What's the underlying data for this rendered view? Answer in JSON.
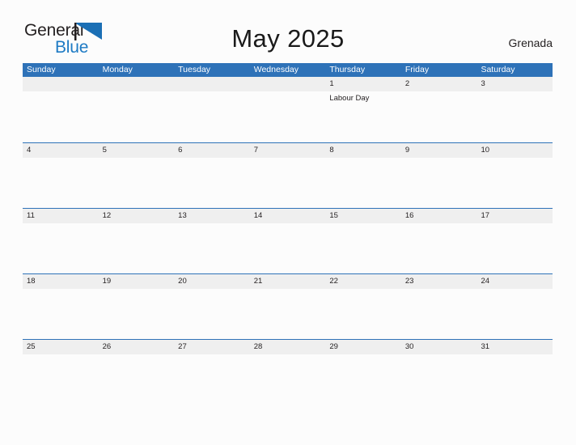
{
  "brand": {
    "name_part1": "General",
    "name_part2": "Blue",
    "flag_icon": "blue-triangle-flag-icon",
    "color_dark": "#231f20",
    "color_blue": "#1d7ac4"
  },
  "header": {
    "title": "May 2025",
    "location": "Grenada"
  },
  "calendar": {
    "accent_color": "#2e72b8",
    "band_color": "#efefef",
    "weekdays": [
      "Sunday",
      "Monday",
      "Tuesday",
      "Wednesday",
      "Thursday",
      "Friday",
      "Saturday"
    ],
    "weeks": [
      [
        {
          "date": ""
        },
        {
          "date": ""
        },
        {
          "date": ""
        },
        {
          "date": ""
        },
        {
          "date": "1",
          "events": [
            "Labour Day"
          ]
        },
        {
          "date": "2"
        },
        {
          "date": "3"
        }
      ],
      [
        {
          "date": "4"
        },
        {
          "date": "5"
        },
        {
          "date": "6"
        },
        {
          "date": "7"
        },
        {
          "date": "8"
        },
        {
          "date": "9"
        },
        {
          "date": "10"
        }
      ],
      [
        {
          "date": "11"
        },
        {
          "date": "12"
        },
        {
          "date": "13"
        },
        {
          "date": "14"
        },
        {
          "date": "15"
        },
        {
          "date": "16"
        },
        {
          "date": "17"
        }
      ],
      [
        {
          "date": "18"
        },
        {
          "date": "19"
        },
        {
          "date": "20"
        },
        {
          "date": "21"
        },
        {
          "date": "22"
        },
        {
          "date": "23"
        },
        {
          "date": "24"
        }
      ],
      [
        {
          "date": "25"
        },
        {
          "date": "26"
        },
        {
          "date": "27"
        },
        {
          "date": "28"
        },
        {
          "date": "29"
        },
        {
          "date": "30"
        },
        {
          "date": "31"
        }
      ]
    ]
  }
}
